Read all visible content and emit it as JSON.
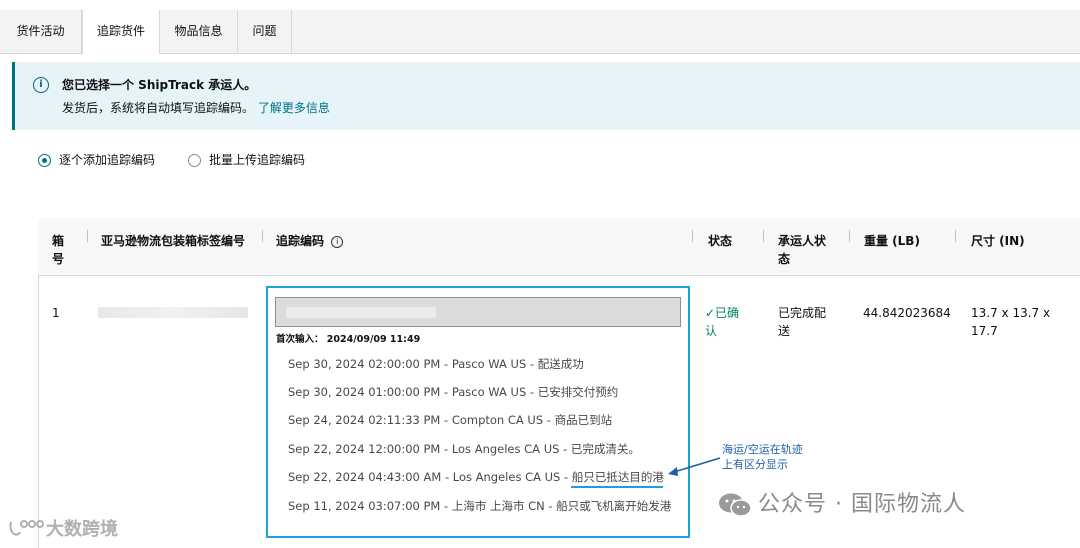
{
  "tabs": [
    {
      "label": "货件活动"
    },
    {
      "label": "追踪货件"
    },
    {
      "label": "物品信息"
    },
    {
      "label": "问题"
    }
  ],
  "banner": {
    "title": "您已选择一个 ShipTrack 承运人。",
    "message": "发货后，系统将自动填写追踪编码。",
    "link": "了解更多信息"
  },
  "radios": [
    {
      "label": "逐个添加追踪编码",
      "selected": true
    },
    {
      "label": "批量上传追踪编码",
      "selected": false
    }
  ],
  "table": {
    "headers": {
      "box_no": "箱号",
      "label_no": "亚马逊物流包装箱标签编号",
      "tracking": "追踪编码",
      "status": "状态",
      "carrier_status": "承运人状态",
      "weight": "重量 (LB)",
      "dimensions": "尺寸 (IN)"
    },
    "row": {
      "box_no": "1",
      "first_input": "首次输入： 2024/09/09 11:49",
      "status": "✓已确认",
      "carrier_status": "已完成配送",
      "weight": "44.842023684",
      "dimensions": "13.7 x 13.7 x 17.7",
      "events": [
        "Sep 30, 2024 02:00:00 PM - Pasco WA US - 配送成功",
        "Sep 30, 2024 01:00:00 PM - Pasco WA US - 已安排交付预约",
        "Sep 24, 2024 02:11:33 PM - Compton CA US - 商品已到站",
        "Sep 22, 2024 12:00:00 PM - Los Angeles CA US - 已完成清关。",
        "Sep 22, 2024 04:43:00 AM - Los Angeles CA US - 船只已抵达目的港",
        "Sep 11, 2024 03:07:00 PM - 上海市 上海市 CN - 船只或飞机离开始发港"
      ]
    }
  },
  "annotation": {
    "line1": "海运/空运在轨迹",
    "line2": "上有区分显示"
  },
  "watermarks": {
    "wechat": "公众号 · 国际物流人",
    "brand": "大数跨境"
  },
  "colors": {
    "accent": "#007185",
    "highlight": "#1aa1d6",
    "status_green": "#067d62",
    "annotation": "#1f5fa8"
  }
}
